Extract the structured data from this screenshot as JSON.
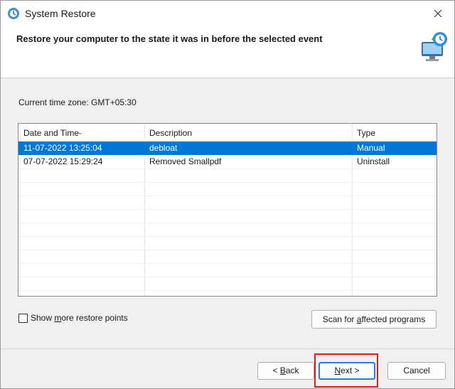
{
  "window": {
    "title": "System Restore",
    "heading": "Restore your computer to the state it was in before the selected event"
  },
  "timezone_text": "Current time zone: GMT+05:30",
  "table": {
    "columns": [
      "Date and Time",
      "Description",
      "Type"
    ],
    "rows": [
      {
        "date": "11-07-2022 13:25:04",
        "description": "debloat",
        "type": "Manual",
        "selected": true
      },
      {
        "date": "07-07-2022 15:29:24",
        "description": "Removed Smallpdf",
        "type": "Uninstall",
        "selected": false
      }
    ]
  },
  "checkbox": {
    "label_pre": "Show ",
    "label_key": "m",
    "label_post": "ore restore points",
    "checked": false
  },
  "buttons": {
    "scan_pre": "Scan for ",
    "scan_key": "a",
    "scan_post": "ffected programs",
    "back_pre": "< ",
    "back_key": "B",
    "back_post": "ack",
    "next_key": "N",
    "next_post": "ext >",
    "cancel": "Cancel"
  },
  "colors": {
    "selection": "#0078d7",
    "highlight_box": "#d12020",
    "default_button_border": "#2f7bd1"
  },
  "icons": {
    "title": "system-restore-icon",
    "header": "restore-monitor-icon",
    "close": "close-icon",
    "sort": "sort-arrow-icon"
  }
}
